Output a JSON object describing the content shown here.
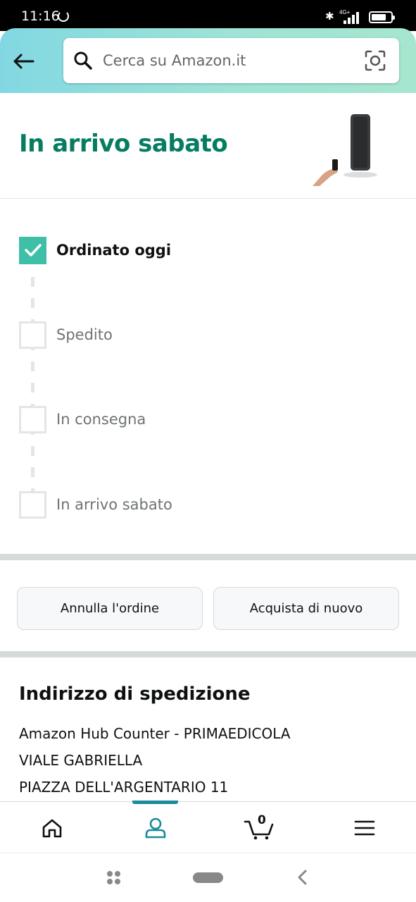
{
  "status_bar": {
    "time": "11:16",
    "network": "4G+",
    "icons": [
      "sync-icon",
      "bluetooth-icon",
      "signal-icon",
      "battery-icon"
    ]
  },
  "header": {
    "back_icon": "arrow-left-icon",
    "search": {
      "placeholder": "Cerca su Amazon.it",
      "value": ""
    },
    "camera_icon": "camera-scan-icon"
  },
  "delivery": {
    "title": "In arrivo sabato",
    "product_image": "product-thumbnail"
  },
  "tracker": {
    "steps": [
      {
        "label": "Ordinato oggi",
        "completed": true
      },
      {
        "label": "Spedito",
        "completed": false
      },
      {
        "label": "In consegna",
        "completed": false
      },
      {
        "label": "In arrivo sabato",
        "completed": false
      }
    ]
  },
  "actions": {
    "cancel_label": "Annulla l'ordine",
    "buy_again_label": "Acquista di nuovo"
  },
  "address": {
    "title": "Indirizzo di spedizione",
    "lines": [
      "Amazon Hub Counter - PRIMAEDICOLA",
      "VIALE GABRIELLA",
      "PIAZZA DELL'ARGENTARIO 11"
    ]
  },
  "bottom_nav": {
    "items": [
      "home-icon",
      "account-icon",
      "cart-icon",
      "menu-icon"
    ],
    "active": "account-icon",
    "cart_count": "0"
  },
  "colors": {
    "accent_green": "#067d62",
    "check_teal": "#3fbfa7",
    "header_gradient_start": "#82d8e2",
    "header_gradient_end": "#a6e6cf",
    "nav_active": "#1b8a9a"
  }
}
